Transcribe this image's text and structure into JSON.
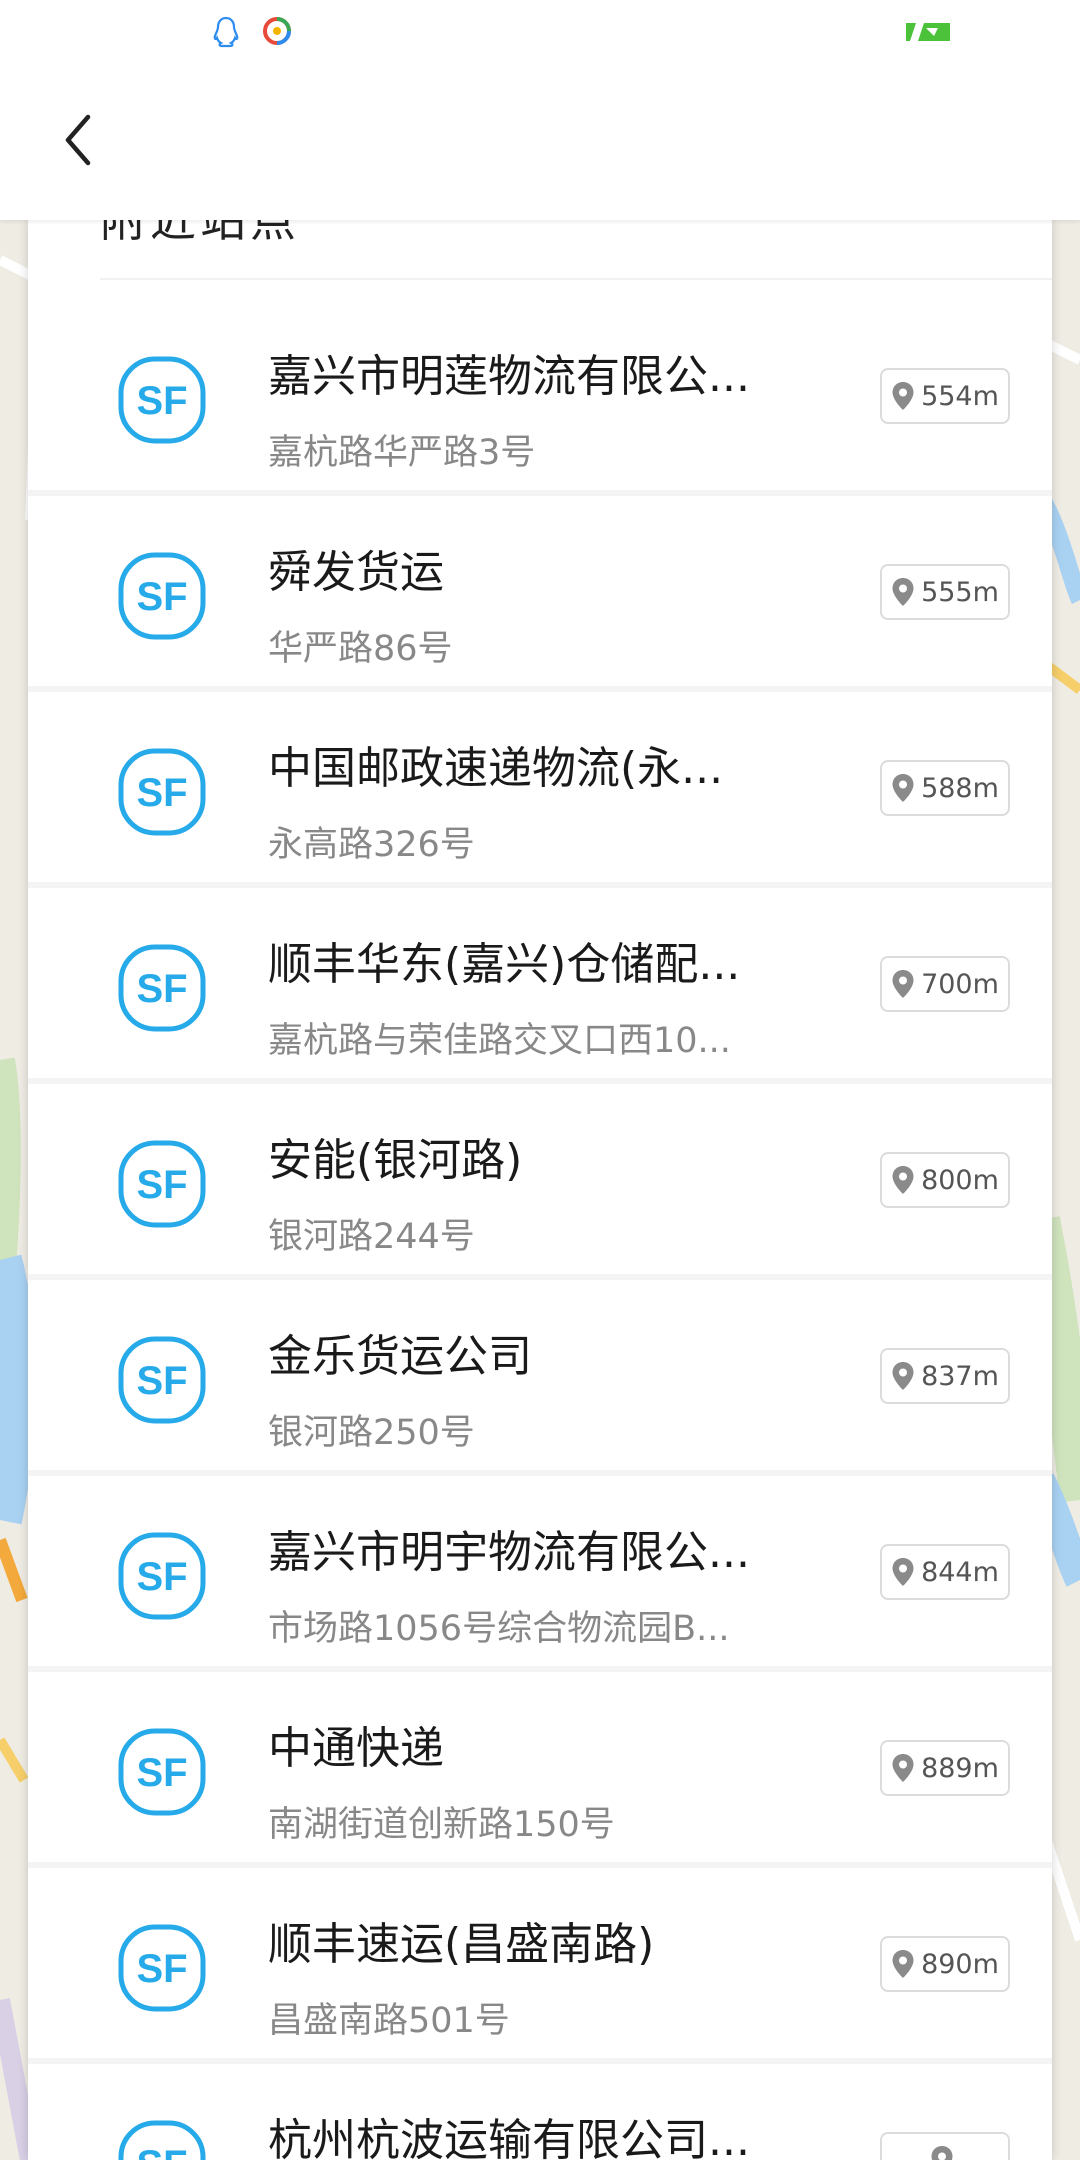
{
  "header": {
    "section_title": "附近站点"
  },
  "colors": {
    "accent": "#1DA4E8",
    "sf_logo_color": "#27AAE9"
  },
  "stations": [
    {
      "name": "嘉兴市明莲物流有限公...",
      "address": "嘉杭路华严路3号",
      "distance": "554m"
    },
    {
      "name": "舜发货运",
      "address": "华严路86号",
      "distance": "555m"
    },
    {
      "name": "中国邮政速递物流(永...",
      "address": "永高路326号",
      "distance": "588m"
    },
    {
      "name": "顺丰华东(嘉兴)仓储配...",
      "address": "嘉杭路与荣佳路交叉口西10...",
      "distance": "700m"
    },
    {
      "name": "安能(银河路)",
      "address": "银河路244号",
      "distance": "800m"
    },
    {
      "name": "金乐货运公司",
      "address": "银河路250号",
      "distance": "837m"
    },
    {
      "name": "嘉兴市明宇物流有限公...",
      "address": "市场路1056号综合物流园B...",
      "distance": "844m"
    },
    {
      "name": "中通快递",
      "address": "南湖街道创新路150号",
      "distance": "889m"
    },
    {
      "name": "顺丰速运(昌盛南路)",
      "address": "昌盛南路501号",
      "distance": "890m"
    },
    {
      "name": "杭州杭波运输有限公司...",
      "address": "",
      "distance": ""
    }
  ]
}
